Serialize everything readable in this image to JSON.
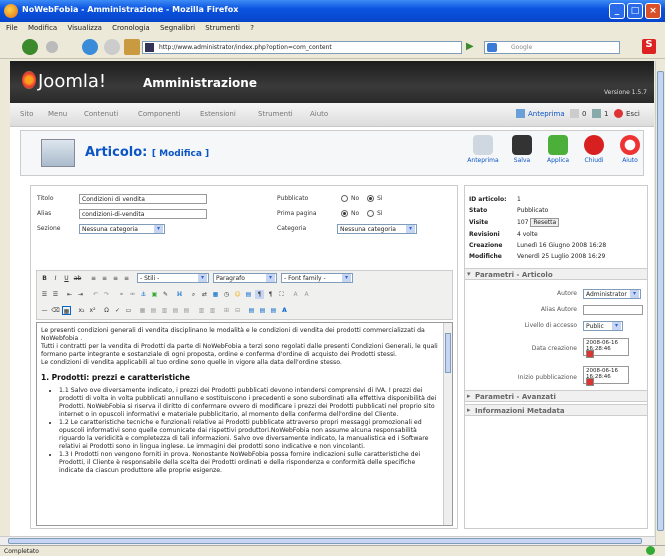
{
  "window": {
    "title": "NoWebFobia - Amministrazione - Mozilla Firefox"
  },
  "browser": {
    "menus": [
      "File",
      "Modifica",
      "Visualizza",
      "Cronologia",
      "Segnalibri",
      "Strumenti",
      "?"
    ],
    "url": "http://www.administrator/index.php?option=com_content",
    "search_placeholder": "Google",
    "status": "Completato"
  },
  "joomla": {
    "logo": "Joomla!",
    "admin_title": "Amministrazione",
    "version": "Versione 1.5.7",
    "menu": [
      "Sito",
      "Menu",
      "Contenuti",
      "Componenti",
      "Estensioni",
      "Strumenti",
      "Aiuto"
    ],
    "right": {
      "preview": "Anteprima",
      "count1": "0",
      "count2": "1",
      "exit": "Esci"
    }
  },
  "toolbar": {
    "title": "Articolo:",
    "subtitle": "[ Modifica ]",
    "buttons": [
      {
        "label": "Anteprima",
        "icon": "preview-icon"
      },
      {
        "label": "Salva",
        "icon": "save-icon"
      },
      {
        "label": "Applica",
        "icon": "apply-icon"
      },
      {
        "label": "Chiudi",
        "icon": "close-icon"
      },
      {
        "label": "Aiuto",
        "icon": "help-icon"
      }
    ]
  },
  "form": {
    "titolo_label": "Titolo",
    "titolo": "Condizioni di vendita",
    "alias_label": "Alias",
    "alias": "condizioni-di-vendita",
    "sezione_label": "Sezione",
    "sezione": "Nessuna categoria",
    "pubblicato_label": "Pubblicato",
    "no": "No",
    "si": "Sì",
    "prima_label": "Prima pagina",
    "categoria_label": "Categoria",
    "categoria": "Nessuna categoria"
  },
  "editor": {
    "style": "- Stili -",
    "format": "Paragrafo",
    "font": "- Font family -",
    "intro": "Le presenti condizioni generali di vendita disciplinano le modalità e le condizioni di vendita dei prodotti commercializzati da NoWebfobia .",
    "p2": "Tutti i contratti per la vendita di Prodotti da parte di NoWebFobia a terzi sono regolati dalle presenti Condizioni Generali, le quali formano parte integrante e sostanziale di ogni proposta, ordine e conferma d'ordine di acquisto dei Prodotti stessi.",
    "p3": "Le condizioni di vendita applicabili al tuo ordine sono quelle in vigore alla data dell'ordine stesso.",
    "heading": "1. Prodotti: prezzi e caratteristiche",
    "items": [
      "1.1 Salvo ove diversamente indicato, i prezzi dei Prodotti pubblicati devono intendersi comprensivi di IVA. I prezzi dei prodotti di volta in volta pubblicati annullano e sostituiscono i precedenti e sono subordinati alla effettiva disponibilità dei Prodotti. NoWebFobia si riserva il diritto di confermare ovvero di modificare i prezzi dei Prodotti pubblicati nel proprio sito internet o in opuscoli informativi e materiale pubblicitario, al momento della conferma dell'ordine del Cliente.",
      "1.2 Le caratteristiche tecniche e funzionali relative ai Prodotti pubblicate attraverso propri messaggi promozionali ed opuscoli informativi sono quelle comunicate dai rispettivi produttori.NoWebFobia non assume alcuna responsabilità riguardo la veridicità e completezza di tali informazioni. Salvo ove diversamente indicato, la manualistica ed i Software relativi ai Prodotti sono in lingua inglese. Le immagini dei prodotti sono indicative e non vincolanti.",
      "1.3 I Prodotti non vengono forniti in prova. Nonostante NoWebFobia possa fornire indicazioni sulle caratteristiche dei Prodotti, il Cliente è responsabile della scelta dei Prodotti ordinati e della rispondenza e conformità delle specifiche indicate da ciascun produttore alle proprie esigenze."
    ]
  },
  "info": {
    "id_label": "ID articolo:",
    "id": "1",
    "stato_label": "Stato",
    "stato": "Pubblicato",
    "visite_label": "Visite",
    "visite": "107",
    "reset": "Resetta",
    "rev_label": "Revisioni",
    "rev": "4 volte",
    "creazione_label": "Creazione",
    "creazione": "Lunedì 16 Giugno 2008 16:28",
    "modifiche_label": "Modifiche",
    "modifiche": "Venerdì 25 Luglio 2008 16:29"
  },
  "params": {
    "header": "Parametri - Articolo",
    "autore_label": "Autore",
    "autore": "Administrator",
    "alias_label": "Alias Autore",
    "livello_label": "Livello di accesso",
    "livello": "Public",
    "data_label": "Data creazione",
    "data": "2008-06-16 16:28:46",
    "inizio_label": "Inizio pubblicazione",
    "inizio": "2008-06-16 16:28:46",
    "advanced": "Parametri - Avanzati",
    "metadata": "Informazioni Metadata"
  }
}
